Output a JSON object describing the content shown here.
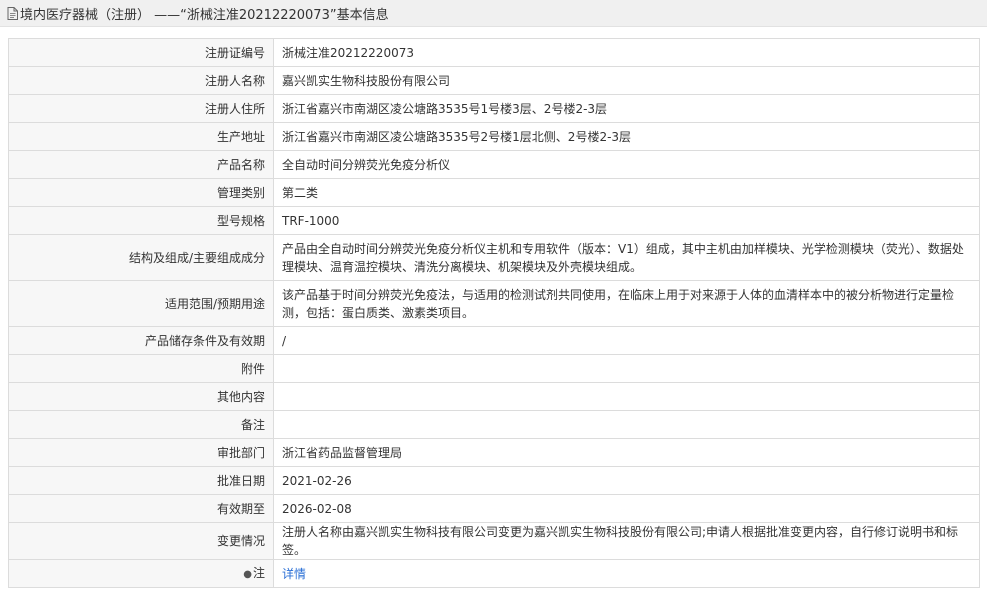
{
  "title": "境内医疗器械（注册） ——“浙械注准20212220073”基本信息",
  "rows": [
    {
      "label": "注册证编号",
      "value": "浙械注准20212220073"
    },
    {
      "label": "注册人名称",
      "value": "嘉兴凯实生物科技股份有限公司"
    },
    {
      "label": "注册人住所",
      "value": "浙江省嘉兴市南湖区凌公塘路3535号1号楼3层、2号楼2-3层"
    },
    {
      "label": "生产地址",
      "value": "浙江省嘉兴市南湖区凌公塘路3535号2号楼1层北侧、2号楼2-3层"
    },
    {
      "label": "产品名称",
      "value": "全自动时间分辨荧光免疫分析仪"
    },
    {
      "label": "管理类别",
      "value": "第二类"
    },
    {
      "label": "型号规格",
      "value": "TRF-1000"
    },
    {
      "label": "结构及组成/主要组成成分",
      "value": "产品由全自动时间分辨荧光免疫分析仪主机和专用软件（版本：V1）组成，其中主机由加样模块、光学检测模块（荧光）、数据处理模块、温育温控模块、清洗分离模块、机架模块及外壳模块组成。"
    },
    {
      "label": "适用范围/预期用途",
      "value": "该产品基于时间分辨荧光免疫法，与适用的检测试剂共同使用，在临床上用于对来源于人体的血清样本中的被分析物进行定量检测，包括：蛋白质类、激素类项目。"
    },
    {
      "label": "产品储存条件及有效期",
      "value": "/"
    },
    {
      "label": "附件",
      "value": ""
    },
    {
      "label": "其他内容",
      "value": ""
    },
    {
      "label": "备注",
      "value": ""
    },
    {
      "label": "审批部门",
      "value": "浙江省药品监督管理局"
    },
    {
      "label": "批准日期",
      "value": "2021-02-26"
    },
    {
      "label": "有效期至",
      "value": "2026-02-08"
    },
    {
      "label": "变更情况",
      "value": "注册人名称由嘉兴凯实生物科技有限公司变更为嘉兴凯实生物科技股份有限公司;申请人根据批准变更内容，自行修订说明书和标签。"
    }
  ],
  "note": {
    "label": "注",
    "link": "详情"
  }
}
